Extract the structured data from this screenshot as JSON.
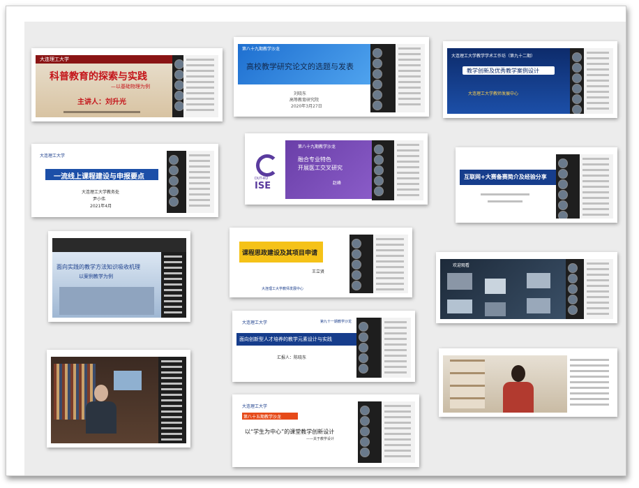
{
  "thumbs": [
    {
      "title": "科普教育的探索与实践",
      "subtitle": "—以基础物理为例",
      "presenter": "主讲人：刘升光",
      "org": "大连理工大学"
    },
    {
      "header": "第八十九期教学沙龙",
      "title": "高校教学研究论文的选题与发表",
      "sub1": "刘晓东",
      "sub2": "高等教育研究院",
      "sub3": "2020年3月27日"
    },
    {
      "title": "教学创新及优秀教学案例设计",
      "sub": "大连理工大学教师发展中心",
      "sub2": "大连理工大学教学学术工作坊（第九十二期）"
    },
    {
      "title": "一流线上课程建设与申报要点",
      "org": "大连理工大学",
      "sub1": "大连理工大学教务处",
      "sub2": "尹小伟",
      "sub3": "2021年4月"
    },
    {
      "header": "第八十九期教学沙龙",
      "title1": "融合专业特色",
      "title2": "开展医工交叉研究",
      "logo": "ISE",
      "logo_sub": "DUT-RU",
      "presenter": "赵峰"
    },
    {
      "title": "互联网+大赛备赛简介及经验分享"
    },
    {
      "title": "面向实践的教学方法知识吸收机理",
      "subtitle": "以案例教学为例"
    },
    {
      "title": "课程思政建设及其项目申请",
      "org": "大连理工大学教师发展中心",
      "presenter": "王立贤"
    },
    {
      "title": "欢迎观看"
    },
    {
      "header": "第九十一期教学沙龙",
      "title": "面向创新型人才培养的教学元素设计与实践",
      "presenter": "汇报人：陈晓东",
      "org": "大连理工大学"
    },
    {},
    {},
    {
      "header": "第八十五期教学沙龙",
      "title": "以“学生为中心”的课堂教学创新设计",
      "sub": "——关于教学设计",
      "org": "大连理工大学"
    }
  ]
}
